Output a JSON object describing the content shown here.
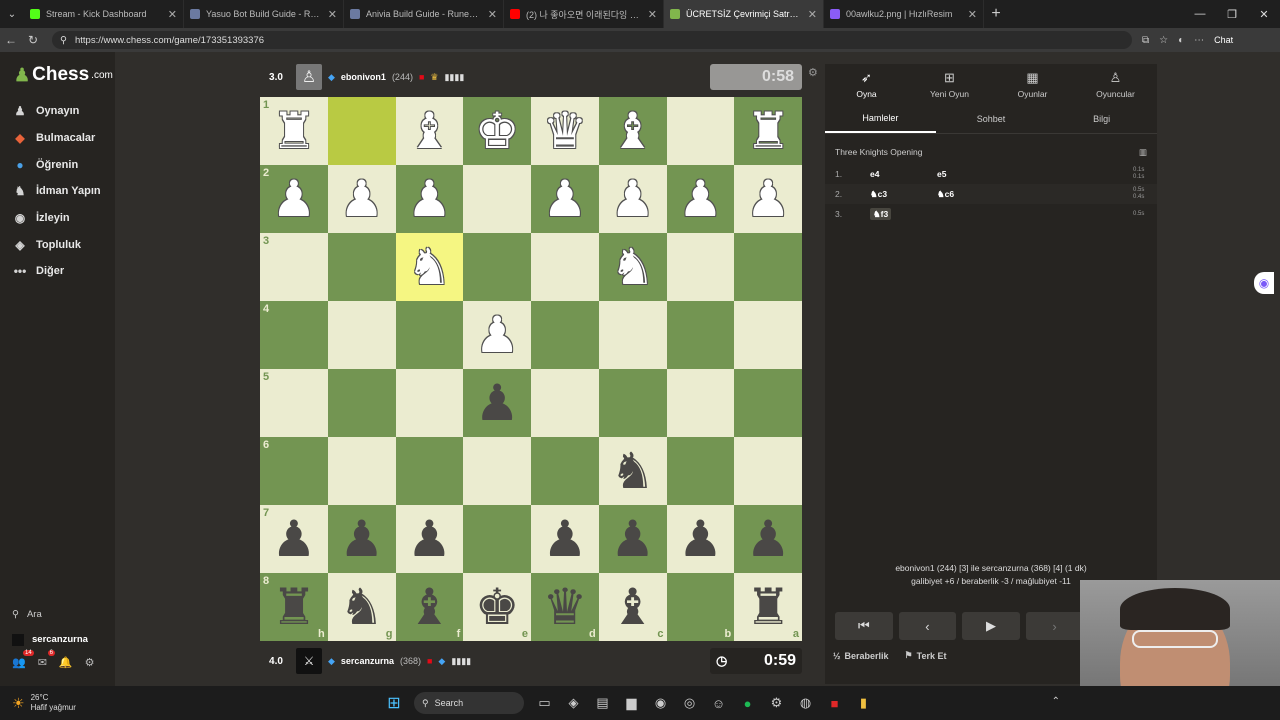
{
  "browser": {
    "tabs": [
      {
        "title": "Stream - Kick Dashboard",
        "color": "#53fc18",
        "active": false
      },
      {
        "title": "Yasuo Bot Build Guide - Runes, Ite",
        "color": "#6b7aa1",
        "active": false
      },
      {
        "title": "Anivia Build Guide - Runes, Items",
        "color": "#6b7aa1",
        "active": false
      },
      {
        "title": "(2) 나 좋아오면 이래된다잉 - YouT",
        "color": "#ff0000",
        "active": false
      },
      {
        "title": "ÜCRETSİZ Çevrimiçi Satranç O",
        "color": "#81b64c",
        "active": true
      },
      {
        "title": "00awlku2.png | HızlıResim",
        "color": "#8a5cf6",
        "active": false
      }
    ],
    "url": "https://www.chess.com/game/173351393376",
    "copilot_label": "Chat"
  },
  "sidebar": {
    "logo_text": "Chess",
    "logo_suffix": ".com",
    "items": [
      {
        "label": "Oynayın",
        "icon": "play-icon",
        "glyph": "♟",
        "color": "#d4d4d4"
      },
      {
        "label": "Bulmacalar",
        "icon": "puzzle-icon",
        "glyph": "◆",
        "color": "#e8633a"
      },
      {
        "label": "Öğrenin",
        "icon": "learn-icon",
        "glyph": "●",
        "color": "#4aa0e6"
      },
      {
        "label": "İdman Yapın",
        "icon": "train-icon",
        "glyph": "♞",
        "color": "#d4d4d4"
      },
      {
        "label": "İzleyin",
        "icon": "watch-icon",
        "glyph": "◉",
        "color": "#d4d4d4"
      },
      {
        "label": "Topluluk",
        "icon": "community-icon",
        "glyph": "◈",
        "color": "#d4d4d4"
      },
      {
        "label": "Diğer",
        "icon": "more-icon",
        "glyph": "•••",
        "color": "#d4d4d4"
      }
    ],
    "search_label": "Ara",
    "username": "sercanzurna",
    "badge_left": "14",
    "badge_mid": "6"
  },
  "top_player": {
    "score": "3.0",
    "name": "ebonivon1",
    "rating": "(244)",
    "clock": "0:58"
  },
  "bottom_player": {
    "score": "4.0",
    "name": "sercanzurna",
    "rating": "(368)",
    "clock": "0:59"
  },
  "board": {
    "ranks": [
      "1",
      "2",
      "3",
      "4",
      "5",
      "6",
      "7",
      "8"
    ],
    "files": [
      "h",
      "g",
      "f",
      "e",
      "d",
      "c",
      "b",
      "a"
    ],
    "rows": [
      [
        "wR",
        "",
        "wB",
        "wK",
        "wQ",
        "wB",
        "",
        "wR"
      ],
      [
        "wP",
        "wP",
        "wP",
        "",
        "wP",
        "wP",
        "wP",
        "wP"
      ],
      [
        "",
        "",
        "wN",
        "",
        "",
        "wN",
        "",
        ""
      ],
      [
        "",
        "",
        "",
        "wP",
        "",
        "",
        "",
        ""
      ],
      [
        "",
        "",
        "",
        "bP",
        "",
        "",
        "",
        ""
      ],
      [
        "",
        "",
        "",
        "",
        "",
        "bN",
        "",
        ""
      ],
      [
        "bP",
        "bP",
        "bP",
        "",
        "bP",
        "bP",
        "bP",
        "bP"
      ],
      [
        "bR",
        "bN",
        "bB",
        "bK",
        "bQ",
        "bB",
        "",
        "bR"
      ]
    ],
    "highlights": [
      [
        0,
        1
      ],
      [
        2,
        2
      ]
    ]
  },
  "panel": {
    "tabs": [
      {
        "label": "Oyna",
        "icon": "rocket-icon",
        "glyph": "➶"
      },
      {
        "label": "Yeni Oyun",
        "icon": "plus-icon",
        "glyph": "⊞"
      },
      {
        "label": "Oyunlar",
        "icon": "board-icon",
        "glyph": "▦"
      },
      {
        "label": "Oyuncular",
        "icon": "players-icon",
        "glyph": "♙"
      }
    ],
    "subtabs": [
      "Hamleler",
      "Sohbet",
      "Bilgi"
    ],
    "opening": "Three Knights Opening",
    "moves": [
      {
        "num": "1.",
        "white": "e4",
        "black": "e5",
        "times": "0.1s 0.1s"
      },
      {
        "num": "2.",
        "white": "♞c3",
        "black": "♞c6",
        "times": "0.5s 0.4s"
      },
      {
        "num": "3.",
        "white": "♞f3",
        "black": "",
        "times": "0.5s"
      }
    ],
    "summary_line1": "ebonivon1 (244) [3] ile sercanzurna (368) [4] (1 dk)",
    "summary_line2": "galibiyet +6 / beraberlik -3 / mağlubiyet -11",
    "draw_label": "Beraberlik",
    "resign_label": "Terk Et"
  },
  "taskbar": {
    "temp": "26°C",
    "weather": "Hafif yağmur",
    "search": "Search"
  }
}
